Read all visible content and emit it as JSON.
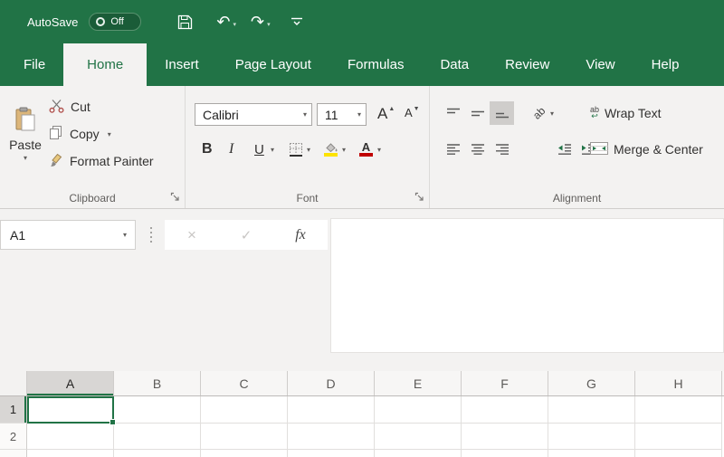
{
  "titlebar": {
    "autosave_label": "AutoSave",
    "autosave_state": "Off"
  },
  "tabs": {
    "active": "Home",
    "items": [
      "File",
      "Home",
      "Insert",
      "Page Layout",
      "Formulas",
      "Data",
      "Review",
      "View",
      "Help"
    ]
  },
  "ribbon": {
    "clipboard": {
      "group_label": "Clipboard",
      "paste_label": "Paste",
      "cut_label": "Cut",
      "copy_label": "Copy",
      "format_painter_label": "Format Painter"
    },
    "font": {
      "group_label": "Font",
      "font_name": "Calibri",
      "font_size": "11",
      "bold": "B",
      "italic": "I",
      "underline": "U",
      "grow_font_glyph": "A",
      "shrink_font_glyph": "A",
      "font_color_glyph": "A"
    },
    "alignment": {
      "group_label": "Alignment",
      "wrap_text_label": "Wrap Text",
      "merge_center_label": "Merge & Center",
      "orientation_glyph": "ab",
      "wrap_glyph": "ab"
    }
  },
  "formula_bar": {
    "name_box": "A1",
    "cancel_glyph": "×",
    "enter_glyph": "✓",
    "fx_label": "fx"
  },
  "grid": {
    "selected_cell": "A1",
    "columns": [
      "A",
      "B",
      "C",
      "D",
      "E",
      "F",
      "G",
      "H"
    ],
    "rows": [
      "1",
      "2"
    ]
  },
  "icons": {
    "caret": "▾",
    "undo": "↶",
    "redo": "↷",
    "up_triangle": "▲",
    "down_triangle": "▼",
    "wrap_arrow": "↩"
  },
  "colors": {
    "excel_green": "#217346",
    "ribbon_bg": "#f3f2f1",
    "fill_yellow": "#fde300",
    "font_red": "#c00000"
  }
}
